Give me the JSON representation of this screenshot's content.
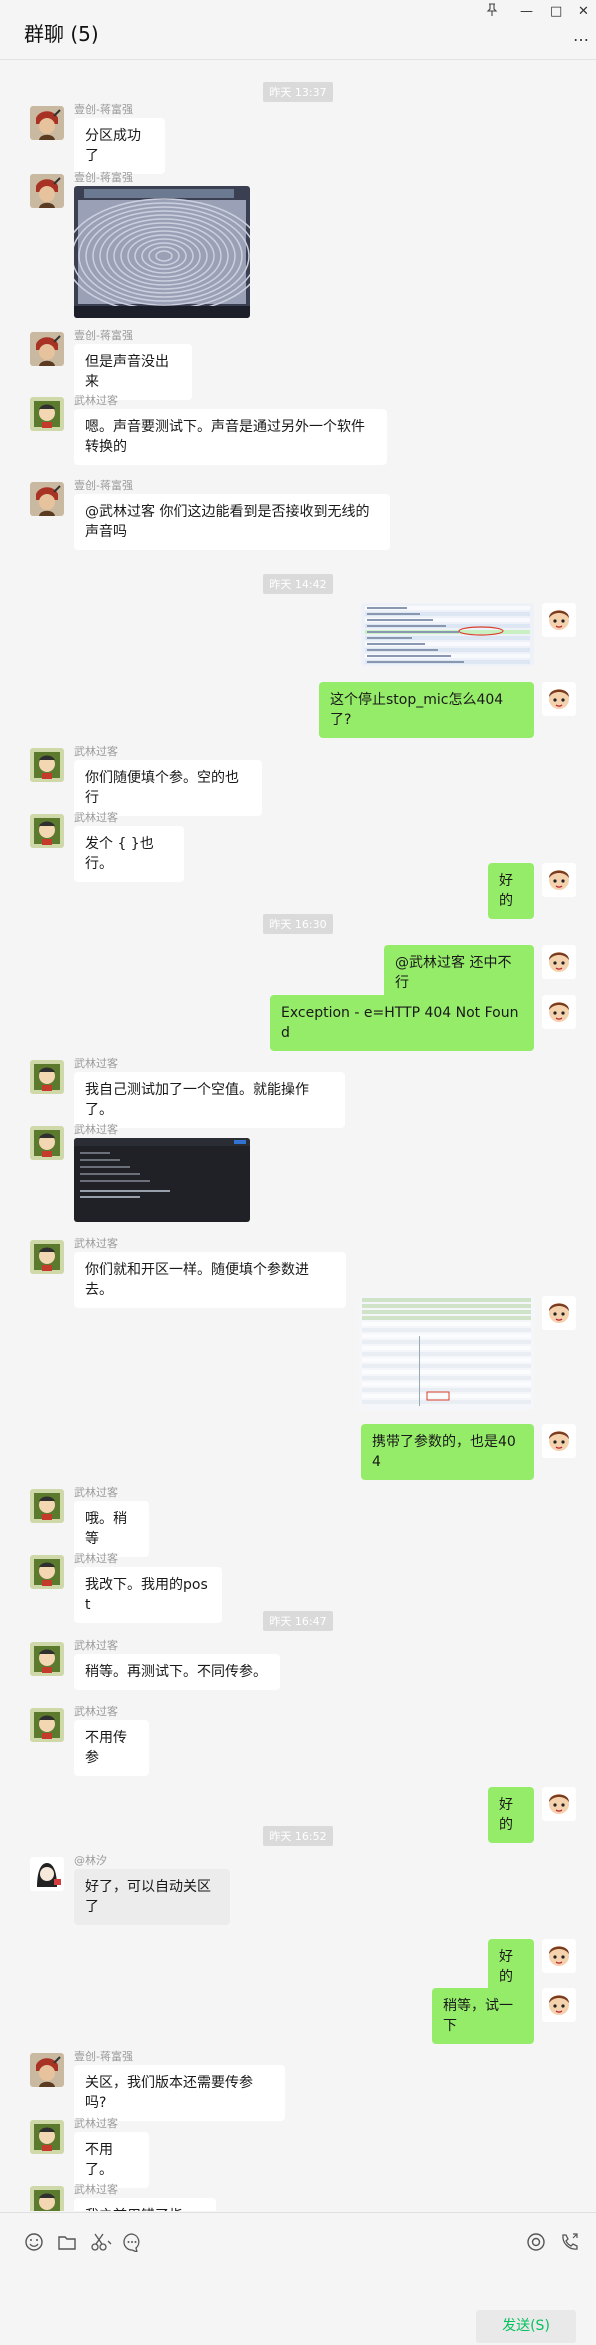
{
  "window": {
    "title": "群聊 (5)",
    "pin_icon": "pin-icon",
    "minimize": "—",
    "maximize": "□",
    "close": "✕",
    "more": "…"
  },
  "messages": [
    {
      "kind": "time",
      "text": "昨天 13:37"
    },
    {
      "kind": "text",
      "side": "left",
      "sender": "壹创-蒋富强",
      "avatar": "warrior",
      "text": "分区成功了"
    },
    {
      "kind": "image",
      "side": "left",
      "sender": "壹创-蒋富强",
      "avatar": "warrior",
      "image": "photo-of-monitor"
    },
    {
      "kind": "text",
      "side": "left",
      "sender": "壹创-蒋富强",
      "avatar": "warrior",
      "text": "但是声音没出来"
    },
    {
      "kind": "text",
      "side": "left",
      "sender": "武林过客",
      "avatar": "cartoon",
      "text": "嗯。声音要测试下。声音是通过另外一个软件转换的"
    },
    {
      "kind": "text",
      "side": "left",
      "sender": "壹创-蒋富强",
      "avatar": "warrior",
      "text": "@武林过客 你们这边能看到是否接收到无线的声音吗"
    },
    {
      "kind": "time",
      "text": "昨天 14:42"
    },
    {
      "kind": "image",
      "side": "right",
      "avatar": "boy",
      "image": "screenshot-of-request-log"
    },
    {
      "kind": "text",
      "side": "right",
      "avatar": "boy",
      "text": "这个停止stop_mic怎么404了?"
    },
    {
      "kind": "text",
      "side": "left",
      "sender": "武林过客",
      "avatar": "cartoon",
      "text": "你们随便填个参。空的也行"
    },
    {
      "kind": "text",
      "side": "left",
      "sender": "武林过客",
      "avatar": "cartoon",
      "text": "发个 { }也行。"
    },
    {
      "kind": "text",
      "side": "right",
      "avatar": "boy",
      "text": "好的"
    },
    {
      "kind": "time",
      "text": "昨天 16:30"
    },
    {
      "kind": "text",
      "side": "right",
      "avatar": "boy",
      "text": "@武林过客 还中不行"
    },
    {
      "kind": "text",
      "side": "right",
      "avatar": "boy",
      "text": "Exception - e=HTTP 404 Not Found"
    },
    {
      "kind": "text",
      "side": "left",
      "sender": "武林过客",
      "avatar": "cartoon",
      "text": "我自己测试加了一个空值。就能操作了。"
    },
    {
      "kind": "image",
      "side": "left",
      "sender": "武林过客",
      "avatar": "cartoon",
      "image": "dark-screenshot-of-api-tool"
    },
    {
      "kind": "text",
      "side": "left",
      "sender": "武林过客",
      "avatar": "cartoon",
      "text": "你们就和开区一样。随便填个参数进去。"
    },
    {
      "kind": "image",
      "side": "right",
      "avatar": "boy",
      "image": "screenshot-of-packet-capture"
    },
    {
      "kind": "text",
      "side": "right",
      "avatar": "boy",
      "text": "携带了参数的，也是404"
    },
    {
      "kind": "text",
      "side": "left",
      "sender": "武林过客",
      "avatar": "cartoon",
      "text": "哦。稍等"
    },
    {
      "kind": "text",
      "side": "left",
      "sender": "武林过客",
      "avatar": "cartoon",
      "text": "我改下。我用的post"
    },
    {
      "kind": "time",
      "text": "昨天 16:47"
    },
    {
      "kind": "text",
      "side": "left",
      "sender": "武林过客",
      "avatar": "cartoon",
      "text": "稍等。再测试下。不同传参。"
    },
    {
      "kind": "text",
      "side": "left",
      "sender": "武林过客",
      "avatar": "cartoon",
      "text": "不用传参"
    },
    {
      "kind": "text",
      "side": "right",
      "avatar": "boy",
      "text": "好的"
    },
    {
      "kind": "time",
      "text": "昨天 16:52"
    },
    {
      "kind": "text",
      "side": "left",
      "sender": "@林汐",
      "avatar": "girl",
      "text": "好了，可以自动关区了",
      "pale": true
    },
    {
      "kind": "text",
      "side": "right",
      "avatar": "boy",
      "text": "好的"
    },
    {
      "kind": "text",
      "side": "right",
      "avatar": "boy",
      "text": "稍等，试一下"
    },
    {
      "kind": "text",
      "side": "left",
      "sender": "壹创-蒋富强",
      "avatar": "warrior",
      "text": "关区，我们版本还需要传参吗?"
    },
    {
      "kind": "text",
      "side": "left",
      "sender": "武林过客",
      "avatar": "cartoon",
      "text": "不用了。"
    },
    {
      "kind": "text",
      "side": "left",
      "sender": "武林过客",
      "avatar": "cartoon",
      "text": "我之前用错了指令。"
    }
  ],
  "toolbar": {
    "emoji_icon": "emoji-icon",
    "folder_icon": "folder-icon",
    "scissors_icon": "scissors-icon",
    "chat_history_icon": "chat-history-icon",
    "live_icon": "live-icon",
    "call_icon": "call-icon",
    "send_label": "发送(S)"
  }
}
